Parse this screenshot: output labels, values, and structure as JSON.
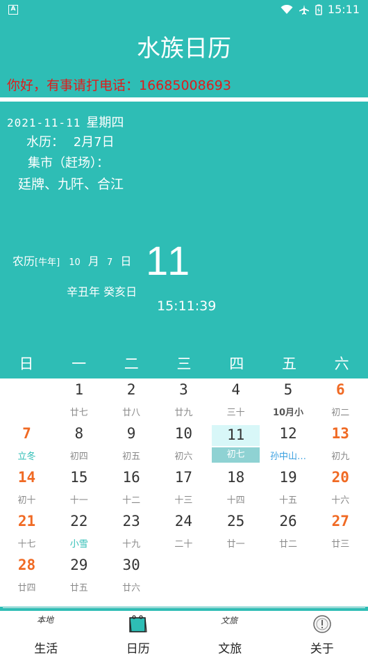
{
  "status": {
    "time": "15:11"
  },
  "header": {
    "title": "水族日历",
    "hotline": "你好，有事请打电话：16685008693"
  },
  "info": {
    "date": "2021-11-11",
    "weekday": "星期四",
    "water_label": "水历：",
    "water_value": "2月7日",
    "market_label": "集市（赶场）：",
    "market_places": "廷牌、九阡、合江",
    "lunar_label": "农历",
    "lunar_year": "[牛年]",
    "lunar_month": "10",
    "month_char": "月",
    "lunar_day": "7",
    "day_char": "日",
    "big_day": "11",
    "ganzhi": "辛丑年 癸亥日",
    "clock": "15:11:39"
  },
  "weekdays": [
    "日",
    "一",
    "二",
    "三",
    "四",
    "五",
    "六"
  ],
  "calendar": [
    {
      "col": 1,
      "row": 0,
      "num": "1",
      "lunar": "廿七"
    },
    {
      "col": 2,
      "row": 0,
      "num": "2",
      "lunar": "廿八"
    },
    {
      "col": 3,
      "row": 0,
      "num": "3",
      "lunar": "廿九"
    },
    {
      "col": 4,
      "row": 0,
      "num": "4",
      "lunar": "三十"
    },
    {
      "col": 5,
      "row": 0,
      "num": "5",
      "lunar": "10月小",
      "style": "bold"
    },
    {
      "col": 6,
      "row": 0,
      "num": "6",
      "lunar": "初二",
      "red": true
    },
    {
      "col": 0,
      "row": 1,
      "num": "7",
      "lunar": "立冬",
      "red": true,
      "style": "term"
    },
    {
      "col": 1,
      "row": 1,
      "num": "8",
      "lunar": "初四"
    },
    {
      "col": 2,
      "row": 1,
      "num": "9",
      "lunar": "初五"
    },
    {
      "col": 3,
      "row": 1,
      "num": "10",
      "lunar": "初六"
    },
    {
      "col": 4,
      "row": 1,
      "num": "11",
      "lunar": "初七",
      "today": true
    },
    {
      "col": 5,
      "row": 1,
      "num": "12",
      "lunar": "孙中山…",
      "style": "fest"
    },
    {
      "col": 6,
      "row": 1,
      "num": "13",
      "lunar": "初九",
      "red": true
    },
    {
      "col": 0,
      "row": 2,
      "num": "14",
      "lunar": "初十",
      "red": true
    },
    {
      "col": 1,
      "row": 2,
      "num": "15",
      "lunar": "十一"
    },
    {
      "col": 2,
      "row": 2,
      "num": "16",
      "lunar": "十二"
    },
    {
      "col": 3,
      "row": 2,
      "num": "17",
      "lunar": "十三"
    },
    {
      "col": 4,
      "row": 2,
      "num": "18",
      "lunar": "十四"
    },
    {
      "col": 5,
      "row": 2,
      "num": "19",
      "lunar": "十五"
    },
    {
      "col": 6,
      "row": 2,
      "num": "20",
      "lunar": "十六",
      "red": true
    },
    {
      "col": 0,
      "row": 3,
      "num": "21",
      "lunar": "十七",
      "red": true
    },
    {
      "col": 1,
      "row": 3,
      "num": "22",
      "lunar": "小雪",
      "style": "term"
    },
    {
      "col": 2,
      "row": 3,
      "num": "23",
      "lunar": "十九"
    },
    {
      "col": 3,
      "row": 3,
      "num": "24",
      "lunar": "二十"
    },
    {
      "col": 4,
      "row": 3,
      "num": "25",
      "lunar": "廿一"
    },
    {
      "col": 5,
      "row": 3,
      "num": "26",
      "lunar": "廿二"
    },
    {
      "col": 6,
      "row": 3,
      "num": "27",
      "lunar": "廿三",
      "red": true
    },
    {
      "col": 0,
      "row": 4,
      "num": "28",
      "lunar": "廿四",
      "red": true
    },
    {
      "col": 1,
      "row": 4,
      "num": "29",
      "lunar": "廿五"
    },
    {
      "col": 2,
      "row": 4,
      "num": "30",
      "lunar": "廿六"
    }
  ],
  "tabs": [
    {
      "label": "生活",
      "icon": "local-life-icon",
      "icon_text": "本地"
    },
    {
      "label": "日历",
      "icon": "calendar-icon"
    },
    {
      "label": "文旅",
      "icon": "culture-tourism-icon",
      "icon_text": "文旅"
    },
    {
      "label": "关于",
      "icon": "info-icon"
    }
  ],
  "colors": {
    "accent": "#2ebdb5",
    "weekend": "#f06a24",
    "hotline": "#e01b1b"
  }
}
